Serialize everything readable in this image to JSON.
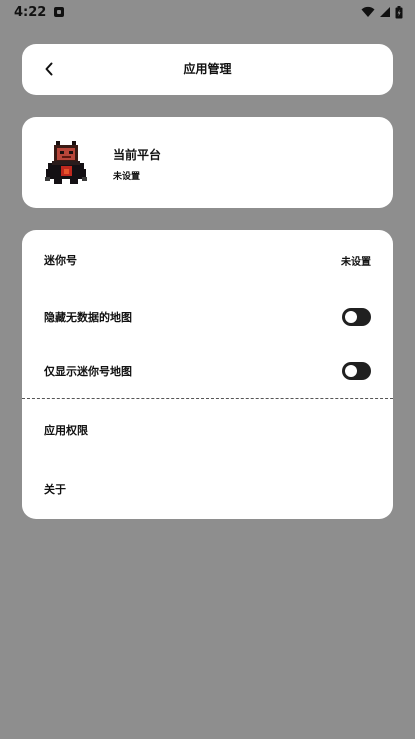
{
  "status_bar": {
    "time": "4:22"
  },
  "header": {
    "title": "应用管理",
    "back_icon": "chevron-left-icon"
  },
  "platform": {
    "label": "当前平台",
    "value": "未设置"
  },
  "settings": {
    "mini_id": {
      "label": "迷你号",
      "value": "未设置"
    },
    "hide_empty_maps": {
      "label": "隐藏无数据的地图",
      "enabled": false
    },
    "only_mini_id_maps": {
      "label": "仅显示迷你号地图",
      "enabled": false
    },
    "permissions": {
      "label": "应用权限"
    },
    "about": {
      "label": "关于"
    }
  }
}
